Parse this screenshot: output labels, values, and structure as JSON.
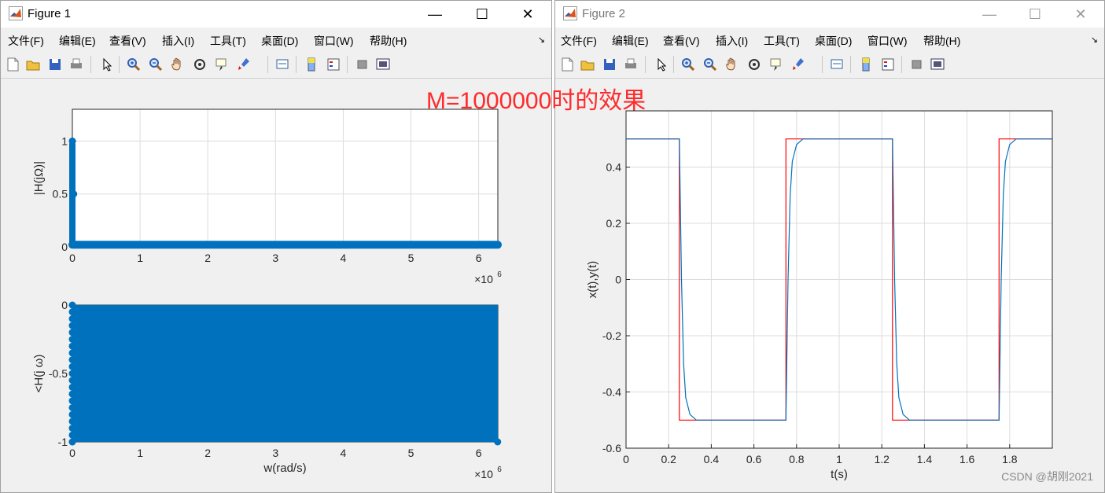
{
  "figure1": {
    "title": "Figure 1",
    "menu": [
      "文件(F)",
      "编辑(E)",
      "查看(V)",
      "插入(I)",
      "工具(T)",
      "桌面(D)",
      "窗口(W)",
      "帮助(H)"
    ],
    "dock": "↘"
  },
  "figure2": {
    "title": "Figure 2",
    "menu": [
      "文件(F)",
      "编辑(E)",
      "查看(V)",
      "插入(I)",
      "工具(T)",
      "桌面(D)",
      "窗口(W)",
      "帮助(H)"
    ],
    "dock": "↘"
  },
  "window_controls": {
    "minimize": "—",
    "maximize": "☐",
    "close": "✕"
  },
  "toolbar_icons": [
    "new-figure-icon",
    "open-icon",
    "save-icon",
    "print-icon",
    "pointer-icon",
    "zoom-in-icon",
    "zoom-out-icon",
    "pan-icon",
    "rotate-icon",
    "data-cursor-icon",
    "brush-icon",
    "link-plot-icon",
    "colorbar-icon",
    "legend-icon",
    "hide-plot-tools-icon",
    "show-plot-tools-icon"
  ],
  "annotation": "M=1000000时的效果",
  "watermark": "CSDN @胡刚2021",
  "colors": {
    "stem": "#0072bd",
    "square_wave": "#ff0000",
    "response": "#0072bd",
    "annotation": "#ff2a2a"
  },
  "chart_data": [
    {
      "type": "scatter",
      "subtype": "stem",
      "xlabel": "",
      "ylabel": "|H(jΩ)|",
      "xlim": [
        0,
        6.2832
      ],
      "ylim": [
        0,
        1.3
      ],
      "x_ticks": [
        "0",
        "1",
        "2",
        "3",
        "4",
        "5",
        "6"
      ],
      "y_ticks": [
        "0",
        "0.5",
        "1"
      ],
      "x_exponent": "×10",
      "x_exponent_power": "6",
      "grid": true,
      "series": [
        {
          "x": [
            0.0,
            0.02,
            0.05,
            1,
            2,
            3,
            4,
            5,
            6,
            6.28
          ],
          "y": [
            1.0,
            0.5,
            0.02,
            0.02,
            0.02,
            0.02,
            0.02,
            0.02,
            0.02,
            0.02
          ]
        }
      ]
    },
    {
      "type": "scatter",
      "subtype": "stem",
      "xlabel": "w(rad/s)",
      "ylabel": "<H(j ω)",
      "xlim": [
        0,
        6.2832
      ],
      "ylim": [
        -1,
        0
      ],
      "x_ticks": [
        "0",
        "1",
        "2",
        "3",
        "4",
        "5",
        "6"
      ],
      "y_ticks": [
        "-1",
        "-0.5",
        "0"
      ],
      "x_exponent": "×10",
      "x_exponent_power": "6",
      "grid": true,
      "series": [
        {
          "x": [
            0,
            6.28
          ],
          "y": [
            -1,
            -1
          ],
          "note_fill": "dense stems fill region from -1 to 0"
        }
      ]
    },
    {
      "type": "line",
      "xlabel": "t(s)",
      "ylabel": "x(t),y(t)",
      "xlim": [
        0,
        2
      ],
      "ylim": [
        -0.6,
        0.6
      ],
      "x_ticks": [
        "0",
        "0.2",
        "0.4",
        "0.6",
        "0.8",
        "1",
        "1.2",
        "1.4",
        "1.6",
        "1.8"
      ],
      "y_ticks": [
        "-0.6",
        "-0.4",
        "-0.2",
        "0",
        "0.2",
        "0.4"
      ],
      "grid": true,
      "series": [
        {
          "x": [
            0,
            0.25,
            0.25,
            0.75,
            0.75,
            1.25,
            1.25,
            1.75,
            1.75,
            2
          ],
          "y": [
            0.5,
            0.5,
            -0.5,
            -0.5,
            0.5,
            0.5,
            -0.5,
            -0.5,
            0.5,
            0.5
          ]
        },
        {
          "x": [
            0,
            0.25,
            0.26,
            0.27,
            0.28,
            0.3,
            0.33,
            0.75,
            0.76,
            0.77,
            0.78,
            0.8,
            0.83,
            1.25,
            1.26,
            1.27,
            1.28,
            1.3,
            1.33,
            1.75,
            1.76,
            1.77,
            1.78,
            1.8,
            1.83,
            2
          ],
          "y": [
            0.5,
            0.5,
            0.0,
            -0.3,
            -0.42,
            -0.48,
            -0.5,
            -0.5,
            0.0,
            0.3,
            0.42,
            0.48,
            0.5,
            0.5,
            0.0,
            -0.3,
            -0.42,
            -0.48,
            -0.5,
            -0.5,
            0.0,
            0.3,
            0.42,
            0.48,
            0.5,
            0.5
          ]
        }
      ]
    }
  ]
}
